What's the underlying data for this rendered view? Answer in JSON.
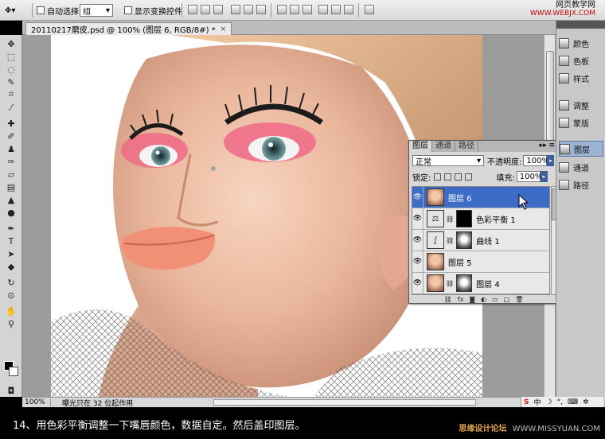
{
  "options_bar": {
    "auto_select_label": "自动选择:",
    "auto_select_value": "组",
    "show_transform_label": "显示变换控件"
  },
  "watermark_top": {
    "site_name": "网页教学网",
    "site_url": "WWW.WEBJX.COM"
  },
  "document": {
    "tab_title": "20110217磨皮.psd @ 100% (图层 6, RGB/8#) *",
    "close_glyph": "×"
  },
  "status_bar": {
    "zoom": "100%",
    "info": "曝光只在 32 位起作用"
  },
  "dock": {
    "items": [
      {
        "label": "颜色",
        "icon": "color-icon"
      },
      {
        "label": "色板",
        "icon": "swatches-icon"
      },
      {
        "label": "样式",
        "icon": "styles-icon"
      },
      {
        "label": "调整",
        "icon": "adjustments-icon"
      },
      {
        "label": "蒙版",
        "icon": "masks-icon"
      },
      {
        "label": "图层",
        "icon": "layers-icon"
      },
      {
        "label": "通道",
        "icon": "channels-icon"
      },
      {
        "label": "路径",
        "icon": "paths-icon"
      }
    ]
  },
  "layers_panel": {
    "tabs": [
      "图层",
      "通道",
      "路径"
    ],
    "blend_mode": "正常",
    "opacity_label": "不透明度:",
    "opacity_value": "100%",
    "lock_label": "锁定:",
    "fill_label": "填充:",
    "fill_value": "100%",
    "layers": [
      {
        "name": "图层 6",
        "selected": true,
        "kind": "pixel"
      },
      {
        "name": "色彩平衡 1",
        "selected": false,
        "kind": "adjustment-color-balance"
      },
      {
        "name": "曲线 1",
        "selected": false,
        "kind": "adjustment-curves"
      },
      {
        "name": "图层 5",
        "selected": false,
        "kind": "pixel"
      },
      {
        "name": "图层 4",
        "selected": false,
        "kind": "pixel-with-mask"
      }
    ]
  },
  "caption": {
    "text": "14、用色彩平衡调整一下嘴唇颜色，数据自定。然后盖印图层。",
    "watermark_brand": "思缘设计论坛",
    "watermark_url": "WWW.MISSYUAN.COM"
  },
  "tray": {
    "s_label": "S",
    "ime": "中"
  },
  "colors": {
    "accent_selection": "#3d6cc6",
    "panel_bg": "#d8d8d8",
    "canvas_bg": "#9c9c9c"
  }
}
